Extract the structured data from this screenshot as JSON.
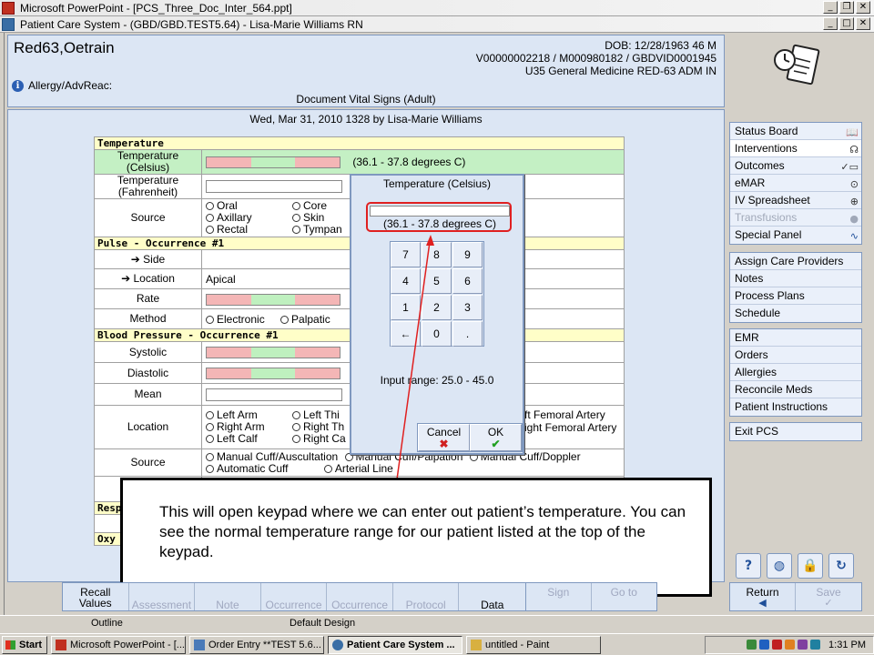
{
  "ppt_window": {
    "title": "Microsoft PowerPoint - [PCS_Three_Doc_Inter_564.ppt]",
    "status_outline": "Outline",
    "status_design": "Default Design"
  },
  "pcs_window": {
    "title": "Patient Care System - (GBD/GBD.TEST5.64) - Lisa-Marie Williams RN"
  },
  "patient": {
    "name": "Red63,Oetrain",
    "dob": "DOB: 12/28/1963 46 M",
    "ids": "V00000002218 / M000980182 / GBDVID0001945",
    "location": "U35 General Medicine  RED-63  ADM IN",
    "allergy": "Allergy/AdvReac:",
    "document_title": "Document Vital Signs (Adult)"
  },
  "entry_header": "Wed,  Mar 31, 2010 1328  by  Lisa-Marie Williams",
  "form": {
    "temperature": {
      "section": "Temperature",
      "celsius_label": "Temperature (Celsius)",
      "celsius_range": "(36.1 - 37.8 degrees C)",
      "fahrenheit_label": "Temperature (Fahrenheit)",
      "source_label": "Source",
      "source_opts": [
        "Oral",
        "Core",
        "Axillary",
        "Skin",
        "Rectal",
        "Tympan"
      ]
    },
    "pulse": {
      "section": "Pulse - Occurrence #1",
      "side_label": "Side",
      "location_label": "Location",
      "location_value": "Apical",
      "rate_label": "Rate",
      "method_label": "Method",
      "method_opts": [
        "Electronic",
        "Palpatic"
      ]
    },
    "bp": {
      "section": "Blood Pressure - Occurrence #1",
      "systolic_label": "Systolic",
      "diastolic_label": "Diastolic",
      "mean_label": "Mean",
      "location_label": "Location",
      "location_opts": [
        "Left Arm",
        "Left Thi",
        "Right Arm",
        "Right Th",
        "Left Calf",
        "Right Ca"
      ],
      "location_right": [
        "ft Femoral Artery",
        "ight Femoral Artery"
      ],
      "source_label": "Source",
      "source_row1": [
        "Manual Cuff/Auscultation",
        "Manual Cuff/Palpation",
        "Manual Cuff/Doppler"
      ],
      "source_row2": [
        "Automatic Cuff",
        "Arterial Line"
      ]
    },
    "resp": {
      "section": "Resp",
      "row_label": "Res"
    },
    "oxy": {
      "section": "Oxy"
    }
  },
  "keypad": {
    "title": "Temperature (Celsius)",
    "range": "(36.1 - 37.8 degrees C)",
    "keys": [
      "7",
      "8",
      "9",
      "4",
      "5",
      "6",
      "1",
      "2",
      "3",
      "←",
      "0",
      "."
    ],
    "input_range": "Input range: 25.0 - 45.0",
    "cancel": "Cancel",
    "ok": "OK"
  },
  "callout": {
    "text": "This will open keypad where we can enter out patient’s temperature. You can see the normal temperature range for our  patient listed at the top of the keypad."
  },
  "nav": {
    "group1": [
      {
        "label": "Status Board",
        "icon": "book-icon"
      },
      {
        "label": "Interventions",
        "icon": "stethoscope-icon"
      },
      {
        "label": "Outcomes",
        "icon": "checklist-icon"
      },
      {
        "label": "eMAR",
        "icon": "pill-icon"
      },
      {
        "label": "IV Spreadsheet",
        "icon": "iv-icon"
      },
      {
        "label": "Transfusions",
        "icon": "blood-drop-icon"
      },
      {
        "label": "Special Panel",
        "icon": "heartbeat-icon"
      }
    ],
    "group2": [
      "Assign Care Providers",
      "Notes",
      "Process Plans",
      "Schedule"
    ],
    "group3": [
      "EMR",
      "Orders",
      "Allergies",
      "Reconcile Meds",
      "Patient Instructions"
    ],
    "group4": [
      "Exit PCS"
    ]
  },
  "bottom": {
    "recall": "Recall Values",
    "assessment": "Assessment",
    "note": "Note",
    "occurrence1": "Occurrence",
    "occurrence2": "Occurrence",
    "protocol": "Protocol",
    "data": "Data",
    "sign": "Sign",
    "goto": "Go to",
    "return": "Return",
    "save": "Save"
  },
  "taskbar": {
    "start": "Start",
    "tasks": [
      "Microsoft PowerPoint - [...",
      "Order Entry **TEST 5.6...",
      "Patient Care System ...",
      "untitled - Paint"
    ],
    "clock": "1:31 PM"
  }
}
